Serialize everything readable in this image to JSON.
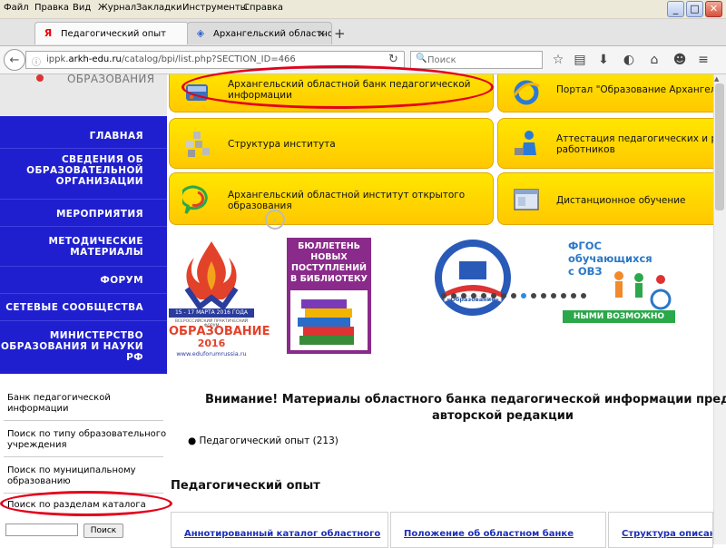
{
  "menubar": {
    "items": [
      "Файл",
      "Правка",
      "Вид",
      "Журнал",
      "Закладки",
      "Инструменты",
      "Справка"
    ]
  },
  "window_buttons": {
    "minimize": "_",
    "maximize": "□",
    "close": "✕"
  },
  "tabs": [
    {
      "label": "Педагогический опыт",
      "icon": "Я",
      "close": "✕",
      "active": true
    },
    {
      "label": "Архангельский областной и...",
      "icon": "◈",
      "close": "✕",
      "active": false
    }
  ],
  "new_tab": "+",
  "address": {
    "url_prefix": "ippk.",
    "url_domain": "arkh-edu.ru",
    "url_path": "/catalog/bpi/list.php?SECTION_ID=466"
  },
  "search": {
    "placeholder": "Поиск"
  },
  "logo": {
    "text": "ОБРАЗОВАНИЯ"
  },
  "left_nav": {
    "items": [
      [
        "ГЛАВНАЯ"
      ],
      [
        "СВЕДЕНИЯ ОБ",
        "ОБРАЗОВАТЕЛЬНОЙ",
        "ОРГАНИЗАЦИИ"
      ],
      [
        "МЕРОПРИЯТИЯ"
      ],
      [
        "МЕТОДИЧЕСКИЕ",
        "МАТЕРИАЛЫ"
      ],
      [
        "ФОРУМ"
      ],
      [
        "СЕТЕВЫЕ СООБЩЕСТВА"
      ],
      [
        "МИНИСТЕРСТВО",
        "ОБРАЗОВАНИЯ И НАУКИ",
        "РФ"
      ]
    ]
  },
  "tiles": [
    [
      "Архангельский областной банк педагогической",
      "информации"
    ],
    [
      "Портал \"Образование Архангель"
    ],
    [
      "Структура института"
    ],
    [
      "Аттестация педагогических и ру",
      "работников"
    ],
    [
      "Архангельский областной институт открытого",
      "образования"
    ],
    [
      "Дистанционное обучение"
    ]
  ],
  "banners": {
    "forum": {
      "date": "15 - 17 МАРТА 2016 ГОДА",
      "subtitle": "ВСЕРОССИЙСКИЙ ПРАКТИЧЕСКИЙ ФОРУМ",
      "title": "ОБРАЗОВАНИЕ",
      "year": "2016",
      "url": "www.eduforumrussia.ru"
    },
    "bulletin": {
      "lines": [
        "БЮЛЛЕТЕНЬ",
        "НОВЫХ",
        "ПОСТУПЛЕНИЙ",
        "В БИБЛИОТЕКУ"
      ]
    },
    "project": {
      "ring": "ПРИОРИТЕТНЫЕ НАЦИОНАЛЬНЫЕ ПРОЕКТЫ",
      "label": "«Образование»"
    },
    "fgos": {
      "lines": [
        "ФГОС",
        "обучающихся",
        "с ОВЗ"
      ],
      "bottom": "НЫМИ ВОЗМОЖНО"
    }
  },
  "carousel": {
    "prev": "‹",
    "dot_count": 15,
    "active_dot": 8
  },
  "side_links": [
    [
      "Банк педагогической",
      "информации"
    ],
    [
      "Поиск по типу образовательного",
      "учреждения"
    ],
    [
      "Поиск по муниципальному",
      "образованию"
    ],
    [
      "Поиск по разделам каталога"
    ]
  ],
  "side_search": {
    "button": "Поиск"
  },
  "notice": {
    "line1": "Внимание! Материалы областного банка педагогической информации пред",
    "line2": "авторской редакции"
  },
  "bullet_item": "Педагогический опыт (213)",
  "section_title": "Педагогический опыт",
  "cards": [
    {
      "link": "Аннотированный каталог областного"
    },
    {
      "link": "Положение об областном банке"
    },
    {
      "link": "Структура описания"
    }
  ],
  "colors": {
    "nav_blue": "#1f1fd0",
    "tile_yellow": "#ffd700",
    "highlight_red": "#e3001b",
    "link_blue": "#1d2fb8"
  }
}
